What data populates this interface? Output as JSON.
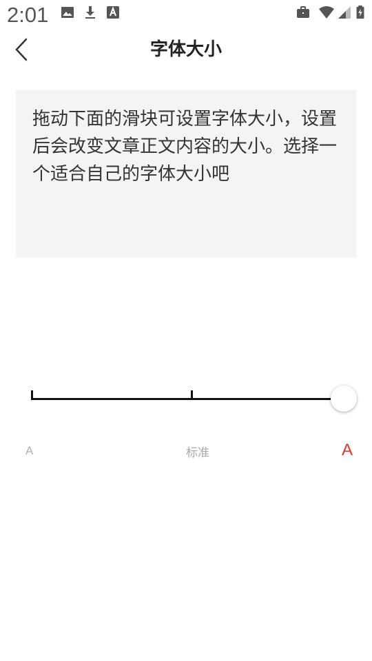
{
  "status_bar": {
    "time": "2:01",
    "icons": [
      "image-icon",
      "download-icon",
      "font-a-icon",
      "briefcase-icon",
      "wifi-icon",
      "signal-icon",
      "battery-icon"
    ]
  },
  "header": {
    "title": "字体大小",
    "back_icon": "chevron-left-icon"
  },
  "preview": {
    "text": "拖动下面的滑块可设置字体大小，设置后会改变文章正文内容的大小。选择一个适合自己的字体大小吧"
  },
  "slider": {
    "steps": 3,
    "selected_index": 2
  },
  "labels": {
    "small": "A",
    "standard": "标准",
    "large": "A"
  },
  "colors": {
    "accent": "#e0382c",
    "preview_bg": "#f4f4f4",
    "track": "#111111"
  }
}
